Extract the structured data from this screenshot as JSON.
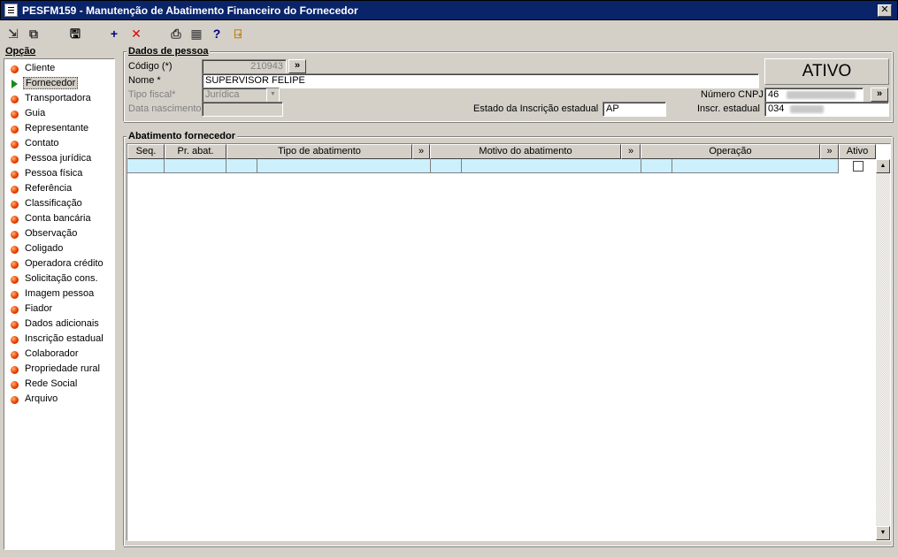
{
  "window": {
    "title": "PESFM159 - Manutenção de Abatimento Financeiro do Fornecedor",
    "close_label": "✕"
  },
  "toolbar": {
    "items": [
      {
        "name": "import-icon",
        "glyph": "⇲"
      },
      {
        "name": "copy-icon",
        "glyph": "⧉"
      },
      {
        "name": "save-icon",
        "glyph": "🖫"
      },
      {
        "name": "add-icon",
        "glyph": "+"
      },
      {
        "name": "delete-icon",
        "glyph": "✕"
      },
      {
        "name": "print-icon",
        "glyph": "⎙"
      },
      {
        "name": "calculator-icon",
        "glyph": "▦"
      },
      {
        "name": "help-icon",
        "glyph": "?"
      },
      {
        "name": "exit-icon",
        "glyph": "⍈"
      }
    ]
  },
  "sidebar": {
    "title": "Opção",
    "selected": "Fornecedor",
    "items": [
      "Cliente",
      "Fornecedor",
      "Transportadora",
      "Guia",
      "Representante",
      "Contato",
      "Pessoa jurídica",
      "Pessoa física",
      "Referência",
      "Classificação",
      "Conta bancária",
      "Observação",
      "Coligado",
      "Operadora crédito",
      "Solicitação cons.",
      "Imagem pessoa",
      "Fiador",
      "Dados adicionais",
      "Inscrição estadual",
      "Colaborador",
      "Propriedade rural",
      "Rede Social",
      "Arquivo"
    ]
  },
  "dados_pessoa": {
    "title": "Dados de pessoa",
    "codigo_label": "Código (*)",
    "codigo_value": "210943",
    "nome_label": "Nome *",
    "nome_value": "SUPERVISOR FELIPE",
    "tipo_fiscal_label": "Tipo fiscal*",
    "tipo_fiscal_value": "Jurídica",
    "data_nascimento_label": "Data nascimento",
    "data_nascimento_value": "",
    "estado_ie_label": "Estado da Inscrição estadual",
    "estado_ie_value": "AP",
    "status": "ATIVO",
    "cnpj_label": "Número CNPJ",
    "cnpj_value": "46",
    "ie_label": "Inscr. estadual",
    "ie_value": "034",
    "lookup_glyph": "»"
  },
  "abatimento": {
    "title": "Abatimento fornecedor",
    "columns": {
      "seq": "Seq.",
      "pr_abat": "Pr. abat.",
      "tipo": "Tipo de abatimento",
      "motivo": "Motivo do abatimento",
      "operacao": "Operação",
      "ativo": "Ativo"
    },
    "lookup_glyph": "»",
    "scroll_up": "▲",
    "scroll_down": "▼"
  }
}
